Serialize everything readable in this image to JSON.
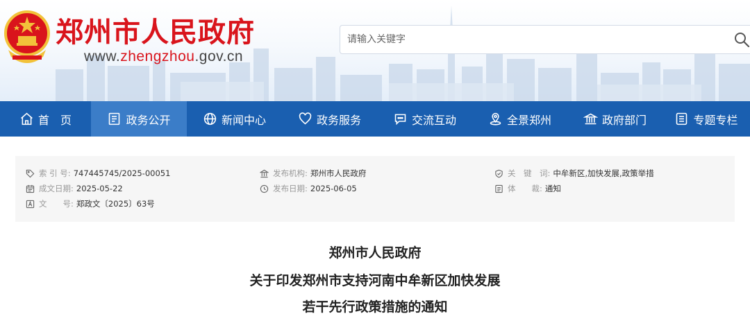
{
  "header": {
    "site_title": "郑州市人民政府",
    "url_prefix": "www.",
    "url_brand": "zhengzhou",
    "url_suffix": ".gov.cn",
    "search_placeholder": "请输入关键字",
    "title_color": "#d9141c",
    "search_icon": "magnifier-icon"
  },
  "nav": {
    "background": "#1a5fb0",
    "active_background": "#3b7dc8",
    "items": [
      {
        "label": "首　页",
        "icon": "home-icon",
        "active": false
      },
      {
        "label": "政务公开",
        "icon": "document-list-icon",
        "active": true
      },
      {
        "label": "新闻中心",
        "icon": "globe-icon",
        "active": false
      },
      {
        "label": "政务服务",
        "icon": "heart-icon",
        "active": false
      },
      {
        "label": "交流互动",
        "icon": "chat-bubble-icon",
        "active": false
      },
      {
        "label": "全景郑州",
        "icon": "location-pin-icon",
        "active": false
      },
      {
        "label": "政府部门",
        "icon": "government-building-icon",
        "active": false
      },
      {
        "label": "专题专栏",
        "icon": "column-list-icon",
        "active": false
      }
    ]
  },
  "meta": {
    "index_label": "索 引 号:",
    "index_value": "747445745/2025-00051",
    "publisher_label": "发布机构:",
    "publisher_value": "郑州市人民政府",
    "keywords_label": "关　键　词:",
    "keywords_value": "中牟新区,加快发展,政策举措",
    "created_label": "成文日期:",
    "created_value": "2025-05-22",
    "published_label": "发布日期:",
    "published_value": "2025-06-05",
    "genre_label": "体　　裁:",
    "genre_value": "通知",
    "docno_label": "文　　号:",
    "docno_value": "郑政文〔2025〕63号"
  },
  "document": {
    "title_line1": "郑州市人民政府",
    "title_line2": "关于印发郑州市支持河南中牟新区加快发展",
    "title_line3": "若干先行政策措施的通知"
  }
}
